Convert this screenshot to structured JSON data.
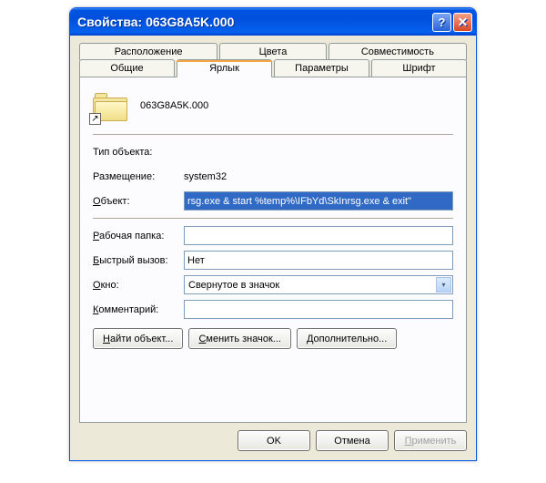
{
  "window": {
    "title": "Свойства: 063G8A5K.000"
  },
  "tabs": {
    "row1": [
      "Расположение",
      "Цвета",
      "Совместимость"
    ],
    "row2": [
      "Общие",
      "Ярлык",
      "Параметры",
      "Шрифт"
    ]
  },
  "shortcut": {
    "filename": "063G8A5K.000",
    "type_label": "Тип объекта:",
    "type_value": "",
    "location_label": "Размещение:",
    "location_value": "system32",
    "target_label": "Объект:",
    "target_value": "rsg.exe & start %temp%\\IFbYd\\SkInrsg.exe & exit\"",
    "workdir_label": "Рабочая папка:",
    "workdir_value": "",
    "hotkey_label": "Быстрый вызов:",
    "hotkey_value": "Нет",
    "runmode_label": "Окно:",
    "runmode_value": "Свернутое в значок",
    "comment_label": "Комментарий:",
    "comment_value": ""
  },
  "labels_ul": {
    "target": "О",
    "target_rest": "бъект:",
    "workdir": "Р",
    "workdir_rest": "абочая папка:",
    "hotkey": "Б",
    "hotkey_rest": "ыстрый вызов:",
    "run": "О",
    "run_rest": "кно:",
    "comment": "К",
    "comment_rest": "омментарий:"
  },
  "buttons": {
    "find": "Найти объект...",
    "find_ul": "Н",
    "find_rest": "айти объект...",
    "icon": "Сменить значок...",
    "icon_ul": "С",
    "icon_rest": "менить значок...",
    "adv": "Дополнительно...",
    "adv_ul": "Д",
    "adv_rest": "ополнительно...",
    "ok": "OK",
    "cancel": "Отмена",
    "apply": "Применить",
    "apply_ul": "П",
    "apply_rest": "рименить"
  }
}
